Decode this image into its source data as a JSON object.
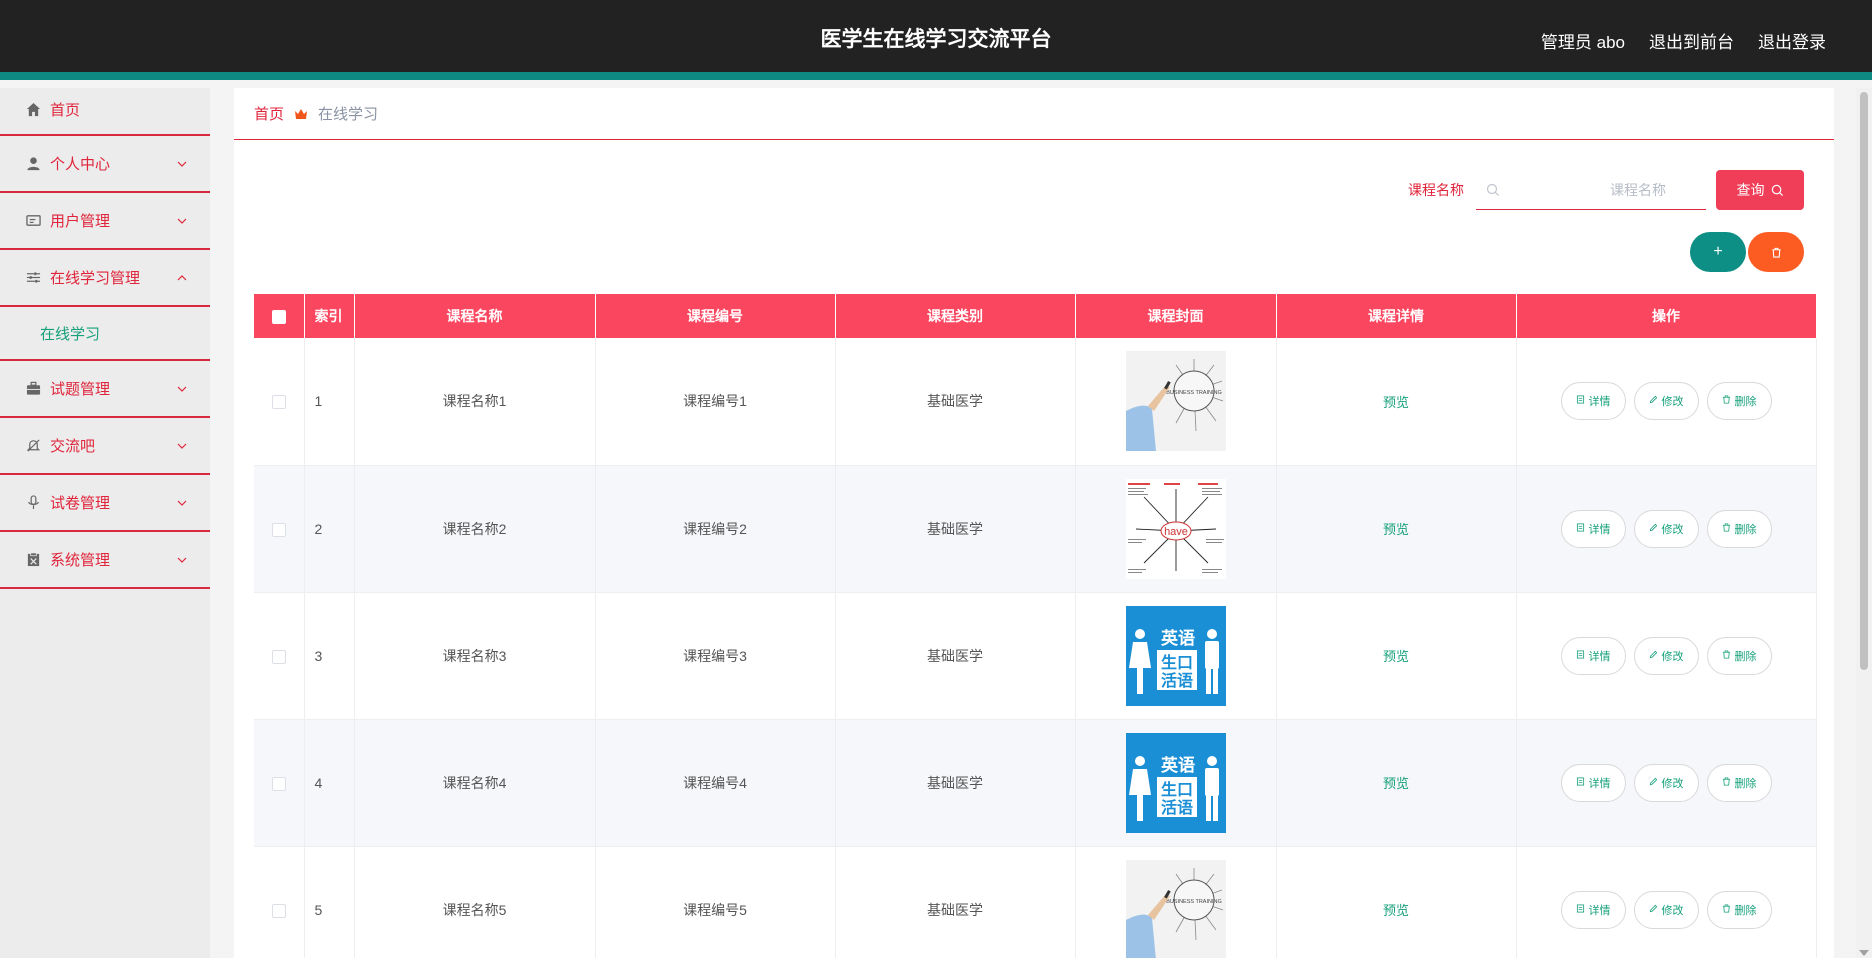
{
  "header": {
    "title": "医学生在线学习交流平台",
    "admin": "管理员 abo",
    "back_to_front": "退出到前台",
    "logout": "退出登录"
  },
  "sidebar": {
    "items": [
      {
        "label": "首页",
        "icon": "home-icon"
      },
      {
        "label": "个人中心",
        "icon": "user-icon"
      },
      {
        "label": "用户管理",
        "icon": "id-card-icon"
      },
      {
        "label": "在线学习管理",
        "icon": "sliders-icon",
        "expanded": true
      },
      {
        "label": "试题管理",
        "icon": "briefcase-icon"
      },
      {
        "label": "交流吧",
        "icon": "bell-off-icon"
      },
      {
        "label": "试卷管理",
        "icon": "microphone-icon"
      },
      {
        "label": "系统管理",
        "icon": "document-icon"
      }
    ],
    "sub_item": "在线学习"
  },
  "breadcrumb": {
    "home": "首页",
    "current": "在线学习"
  },
  "search": {
    "label": "课程名称",
    "placeholder": "课程名称",
    "button": "查询"
  },
  "actions": {
    "add": "+"
  },
  "table": {
    "columns": [
      "索引",
      "课程名称",
      "课程编号",
      "课程类别",
      "课程封面",
      "课程详情",
      "操作"
    ],
    "rows": [
      {
        "index": "1",
        "name": "课程名称1",
        "code": "课程编号1",
        "category": "基础医学",
        "cover": "business-training",
        "detail": "预览"
      },
      {
        "index": "2",
        "name": "课程名称2",
        "code": "课程编号2",
        "category": "基础医学",
        "cover": "have-grammar",
        "detail": "预览"
      },
      {
        "index": "3",
        "name": "课程名称3",
        "code": "课程编号3",
        "category": "基础医学",
        "cover": "english-life",
        "detail": "预览"
      },
      {
        "index": "4",
        "name": "课程名称4",
        "code": "课程编号4",
        "category": "基础医学",
        "cover": "english-life",
        "detail": "预览"
      },
      {
        "index": "5",
        "name": "课程名称5",
        "code": "课程编号5",
        "category": "基础医学",
        "cover": "business-training",
        "detail": "预览"
      }
    ],
    "ops": {
      "detail": "详情",
      "edit": "修改",
      "delete": "删除"
    }
  },
  "cover_text": {
    "business_training": "BUSINESS TRAINING",
    "have": "have",
    "english_1": "英语",
    "english_2": "生口",
    "english_3": "活语"
  },
  "colors": {
    "accent": "#fb4660",
    "teal": "#0e8f85",
    "orange": "#fc5b22",
    "green_text": "#16a07a",
    "header_bg": "#222222"
  }
}
